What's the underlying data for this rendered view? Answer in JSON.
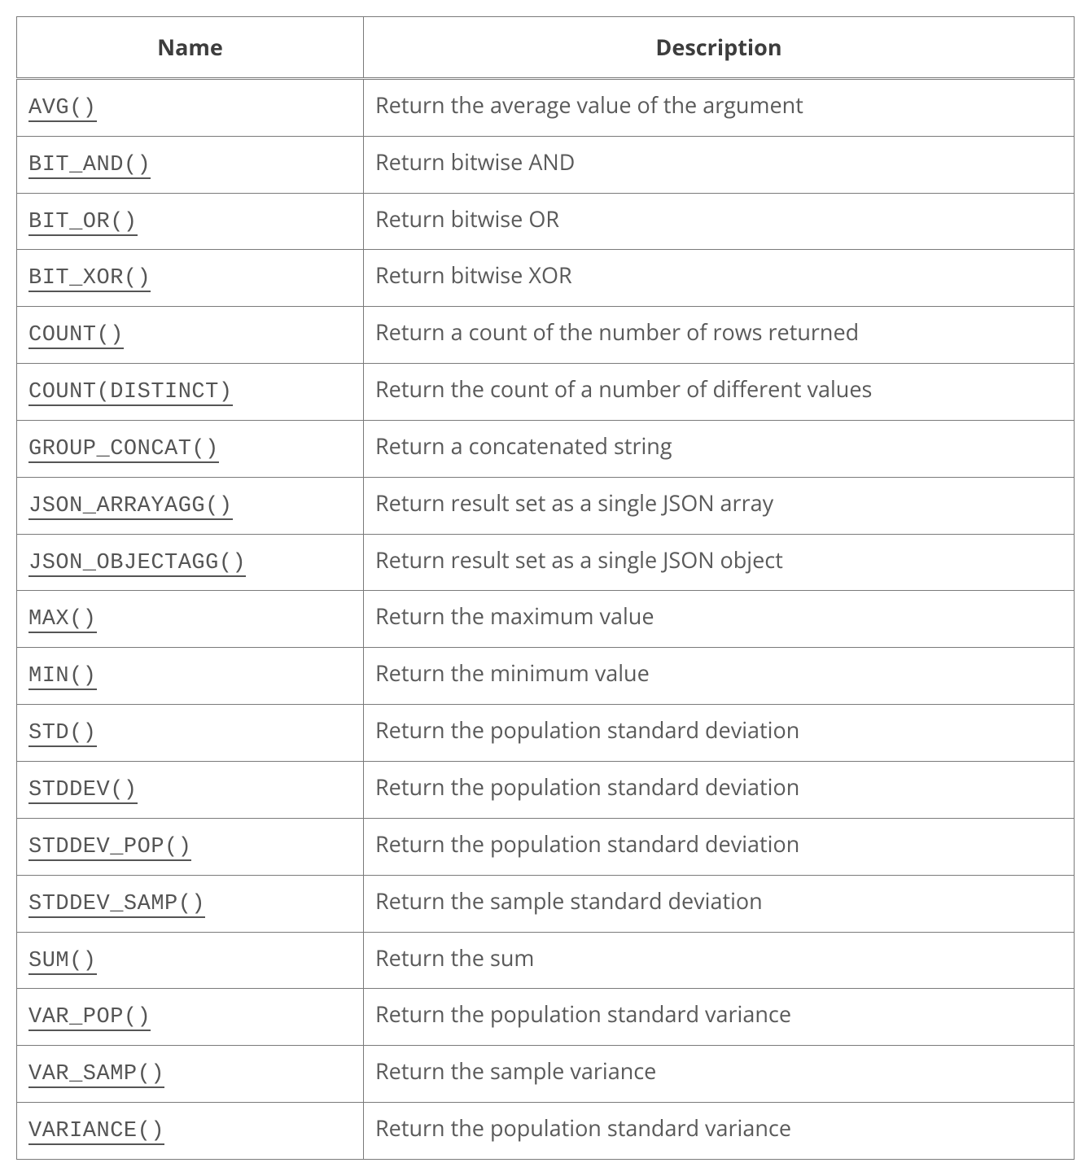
{
  "table": {
    "headers": {
      "name": "Name",
      "description": "Description"
    },
    "rows": [
      {
        "fn": "AVG()",
        "desc": "Return the average value of the argument"
      },
      {
        "fn": "BIT_AND()",
        "desc": "Return bitwise AND"
      },
      {
        "fn": "BIT_OR()",
        "desc": "Return bitwise OR"
      },
      {
        "fn": "BIT_XOR()",
        "desc": "Return bitwise XOR"
      },
      {
        "fn": "COUNT()",
        "desc": "Return a count of the number of rows returned"
      },
      {
        "fn": "COUNT(DISTINCT)",
        "desc": "Return the count of a number of different values"
      },
      {
        "fn": "GROUP_CONCAT()",
        "desc": "Return a concatenated string"
      },
      {
        "fn": "JSON_ARRAYAGG()",
        "desc": "Return result set as a single JSON array"
      },
      {
        "fn": "JSON_OBJECTAGG()",
        "desc": "Return result set as a single JSON object"
      },
      {
        "fn": "MAX()",
        "desc": "Return the maximum value"
      },
      {
        "fn": "MIN()",
        "desc": "Return the minimum value"
      },
      {
        "fn": "STD()",
        "desc": "Return the population standard deviation"
      },
      {
        "fn": "STDDEV()",
        "desc": "Return the population standard deviation"
      },
      {
        "fn": "STDDEV_POP()",
        "desc": "Return the population standard deviation"
      },
      {
        "fn": "STDDEV_SAMP()",
        "desc": "Return the sample standard deviation"
      },
      {
        "fn": "SUM()",
        "desc": "Return the sum"
      },
      {
        "fn": "VAR_POP()",
        "desc": "Return the population standard variance"
      },
      {
        "fn": "VAR_SAMP()",
        "desc": "Return the sample variance"
      },
      {
        "fn": "VARIANCE()",
        "desc": "Return the population standard variance"
      }
    ]
  }
}
